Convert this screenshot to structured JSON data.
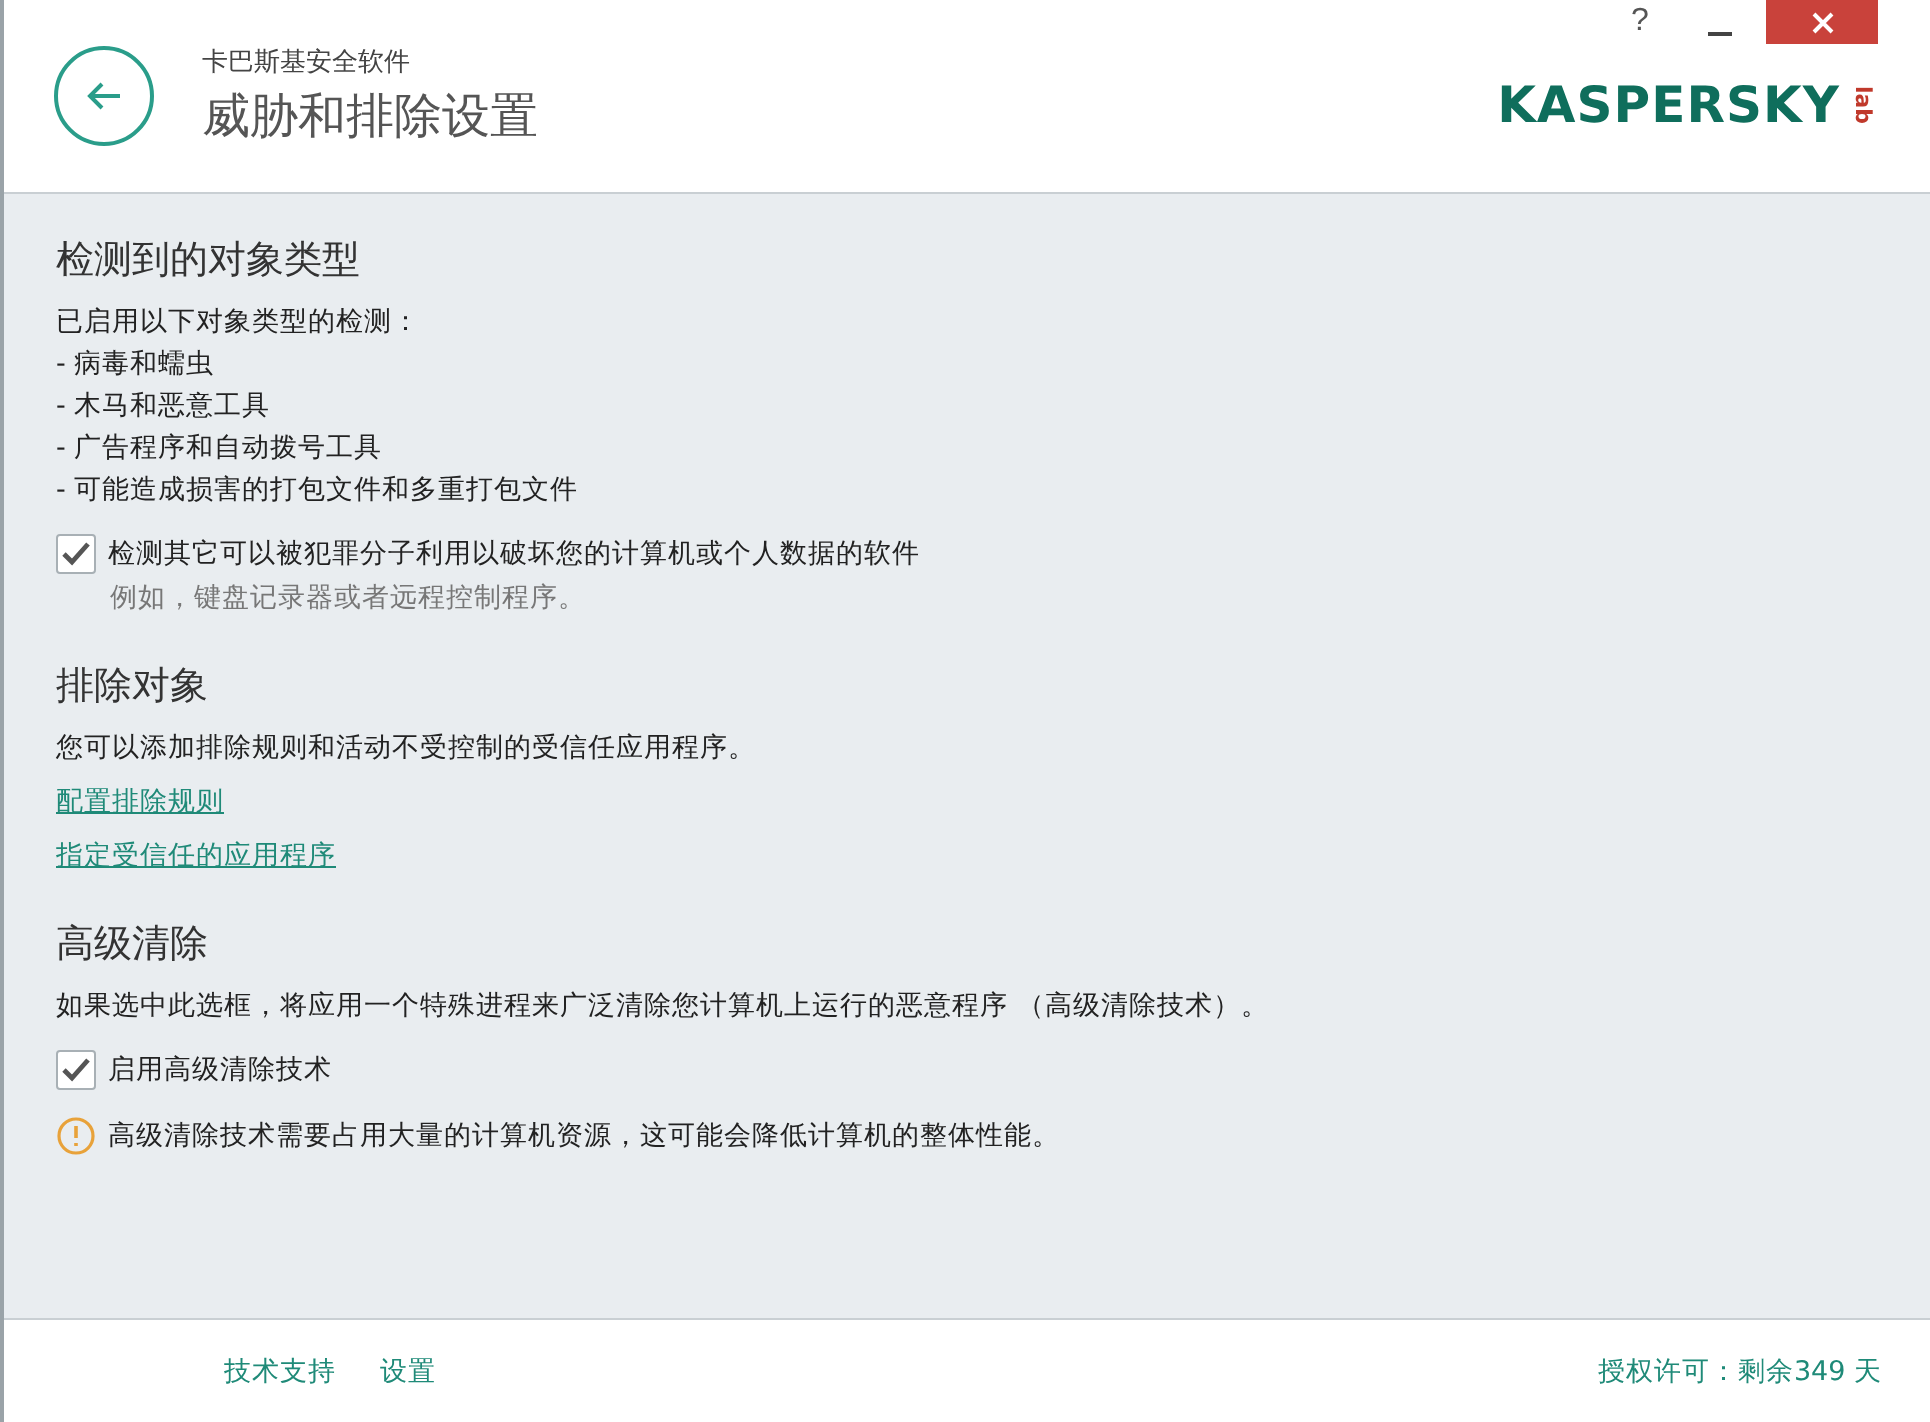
{
  "window": {
    "help": "?",
    "app_name": "卡巴斯基安全软件",
    "title": "威胁和排除设置",
    "logo": "KASPERSKY",
    "logo_suffix": "lab"
  },
  "sections": [
    {
      "heading": "检测到的对象类型",
      "items": [
        {
          "kind": "text",
          "text": "已启用以下对象类型的检测："
        },
        {
          "kind": "text",
          "text": "- 病毒和蠕虫"
        },
        {
          "kind": "text",
          "text": "- 木马和恶意工具"
        },
        {
          "kind": "text",
          "text": "- 广告程序和自动拨号工具"
        },
        {
          "kind": "text",
          "text": "- 可能造成损害的打包文件和多重打包文件"
        },
        {
          "kind": "checkbox",
          "text": "检测其它可以被犯罪分子利用以破坏您的计算机或个人数据的软件",
          "checked": true,
          "hint": "例如，键盘记录器或者远程控制程序。"
        }
      ]
    },
    {
      "heading": "排除对象",
      "items": [
        {
          "kind": "text",
          "text": "您可以添加排除规则和活动不受控制的受信任应用程序。"
        },
        {
          "kind": "link",
          "text": "配置排除规则"
        },
        {
          "kind": "link",
          "text": "指定受信任的应用程序"
        }
      ]
    },
    {
      "heading": "高级清除",
      "items": [
        {
          "kind": "text",
          "text": "如果选中此选框，将应用一个特殊进程来广泛清除您计算机上运行的恶意程序 （高级清除技术）。"
        },
        {
          "kind": "checkbox",
          "text": "启用高级清除技术",
          "checked": true
        },
        {
          "kind": "warning",
          "text": "高级清除技术需要占用大量的计算机资源，这可能会降低计算机的整体性能。"
        }
      ]
    }
  ],
  "footer": {
    "links": [
      "技术支持",
      "设置"
    ],
    "license": "授权许可：剩余349 天"
  }
}
